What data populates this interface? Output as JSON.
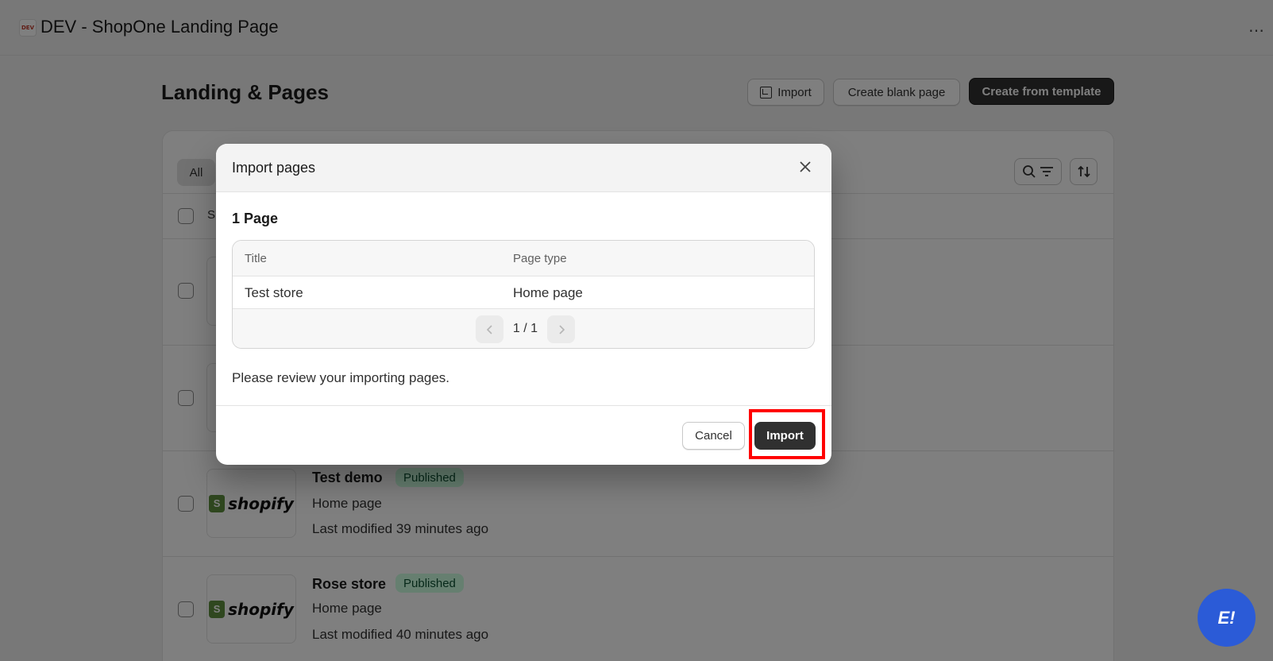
{
  "app": {
    "icon_text": "DEV",
    "title": "DEV - ShopOne Landing Page",
    "more_icon": "⋯"
  },
  "page": {
    "title": "Landing & Pages",
    "import_label": "Import",
    "create_blank_label": "Create blank page",
    "create_template_label": "Create from template"
  },
  "list": {
    "tab_all": "All",
    "column_partial": "S",
    "rows": [
      {
        "title": "Test demo",
        "status": "Published",
        "page_type": "Home page",
        "modified": "Last modified 39 minutes ago"
      },
      {
        "title": "Rose store",
        "status": "Published",
        "page_type": "Home page",
        "modified": "Last modified 40 minutes ago"
      }
    ],
    "shopify_word": "shopify",
    "shopify_bag": "S"
  },
  "modal": {
    "title": "Import pages",
    "count": "1 Page",
    "columns": [
      "Title",
      "Page type"
    ],
    "rows": [
      {
        "title": "Test store",
        "page_type": "Home page"
      }
    ],
    "pagination": "1 / 1",
    "review_text": "Please review your importing pages.",
    "cancel_label": "Cancel",
    "import_label": "Import"
  },
  "chat": {
    "icon_text": "E!"
  },
  "colors": {
    "primary": "#303030",
    "badge_bg": "#cdfee1",
    "highlight": "#ff0000",
    "chat": "#2b5bd7"
  }
}
